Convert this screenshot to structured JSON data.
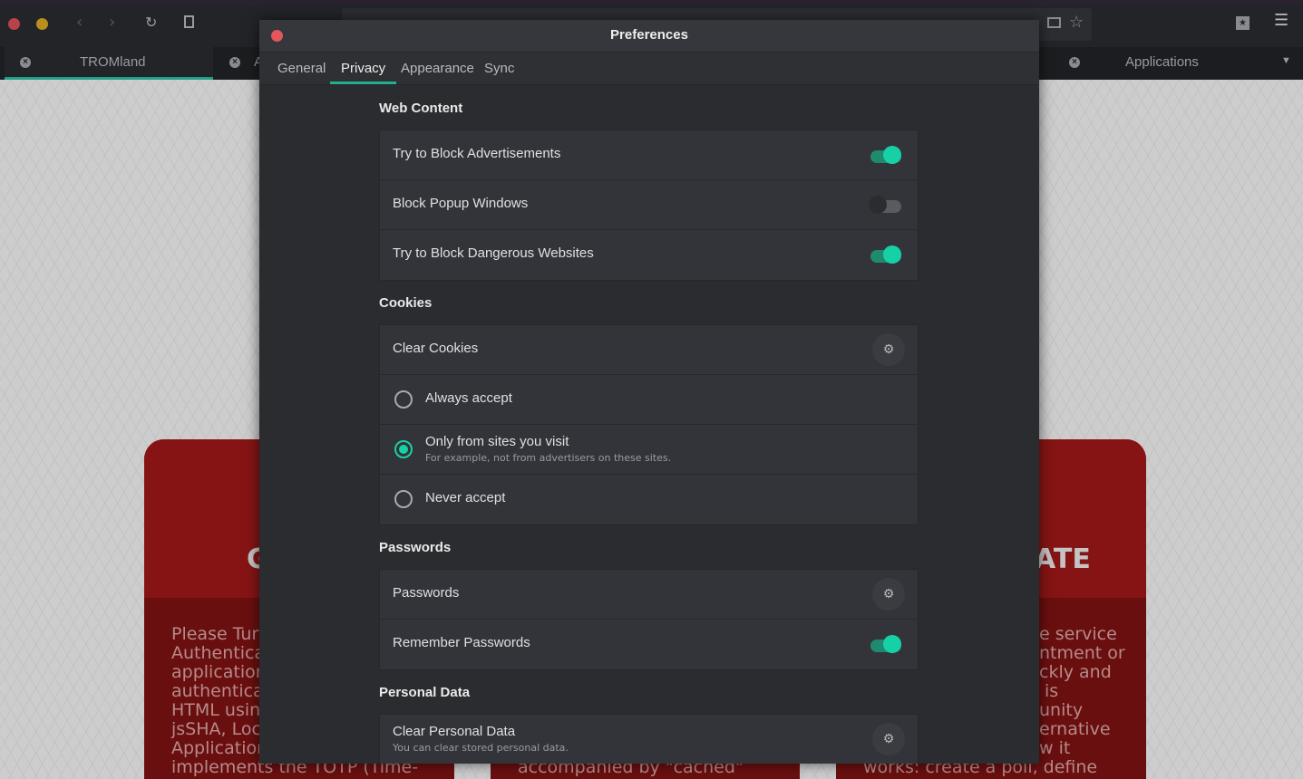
{
  "browser": {
    "tabs": [
      {
        "title": "TROMland",
        "active": true
      },
      {
        "title": "A",
        "active": false
      },
      {
        "title": "Applications",
        "active": false
      }
    ],
    "icons": [
      "back-icon",
      "forward-icon",
      "reload-icon",
      "new-page-icon",
      "reader-icon",
      "star-icon",
      "bookmarks-icon",
      "menu-icon"
    ]
  },
  "page": {
    "cards": [
      {
        "title": "G",
        "lines": [
          "Please Turn",
          "Authentica",
          "application",
          "authenticat",
          "HTML using",
          "jsSHA, Loca",
          "Application",
          "implements the TOTP (Time-"
        ]
      },
      {
        "title": "",
        "lines": [
          "accompanied by \"cached\""
        ]
      },
      {
        "title": "ATE",
        "lines": [
          "e service",
          "ntment or",
          "ckly and",
          "is",
          "unity",
          "ernative",
          "w it",
          "works: create a poll, define"
        ]
      }
    ]
  },
  "dialog": {
    "title": "Preferences",
    "tabs": [
      "General",
      "Privacy",
      "Appearance",
      "Sync"
    ],
    "active_tab": "Privacy",
    "accent": "#17d1a6",
    "sections": {
      "web": {
        "title": "Web Content",
        "items": [
          {
            "label": "Try to Block Advertisements",
            "on": true
          },
          {
            "label": "Block Popup Windows",
            "on": false
          },
          {
            "label": "Try to Block Dangerous Websites",
            "on": true
          }
        ]
      },
      "cookies": {
        "title": "Cookies",
        "clear": "Clear Cookies",
        "options": [
          {
            "label": "Always accept",
            "selected": false
          },
          {
            "label": "Only from sites you visit",
            "sub": "For example, not from advertisers on these sites.",
            "selected": true
          },
          {
            "label": "Never accept",
            "selected": false
          }
        ]
      },
      "passwords": {
        "title": "Passwords",
        "manage": "Passwords",
        "remember": {
          "label": "Remember Passwords",
          "on": true
        }
      },
      "personal": {
        "title": "Personal Data",
        "clear": "Clear Personal Data",
        "sub": "You can clear stored personal data."
      }
    }
  }
}
